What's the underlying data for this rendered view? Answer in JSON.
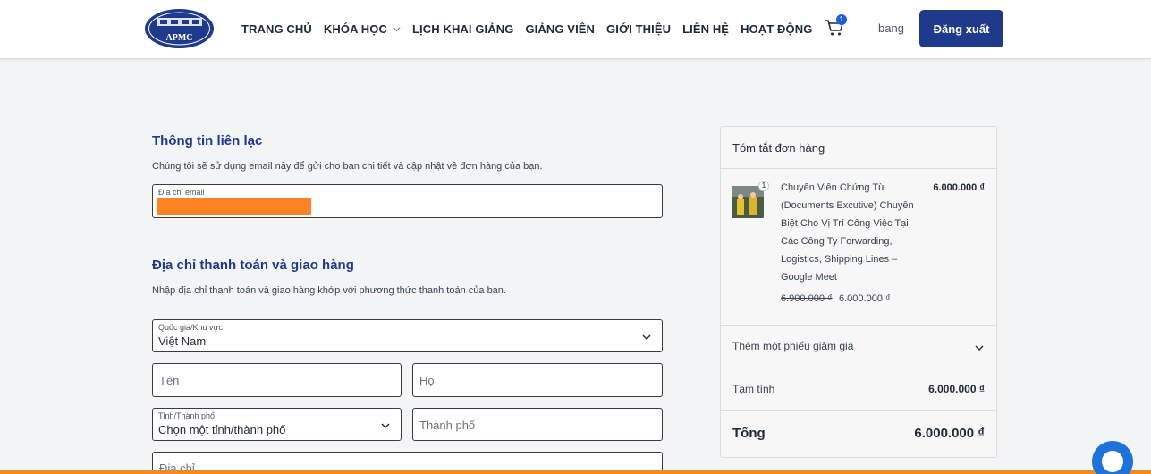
{
  "header": {
    "logo_text": "APMC",
    "nav": [
      {
        "label": "TRANG CHỦ"
      },
      {
        "label": "KHÓA HỌC",
        "has_dropdown": true
      },
      {
        "label": "LỊCH KHAI GIẢNG"
      },
      {
        "label": "GIẢNG VIÊN"
      },
      {
        "label": "GIỚI THIỆU"
      },
      {
        "label": "LIÊN HỆ"
      },
      {
        "label": "HOẠT ĐỘNG"
      }
    ],
    "cart_count": "1",
    "username": "bang",
    "logout_label": "Đăng xuất"
  },
  "contact": {
    "title": "Thông tin liên lạc",
    "description": "Chúng tôi sẽ sử dụng email này để gửi cho bạn chi tiết và cập nhật về đơn hàng của bạn.",
    "email_label": "Địa chỉ email"
  },
  "billing": {
    "title": "Địa chỉ thanh toán và giao hàng",
    "description": "Nhập địa chỉ thanh toán và giao hàng khớp với phương thức thanh toán của bạn.",
    "country_label": "Quốc gia/Khu vực",
    "country_value": "Việt Nam",
    "first_name_placeholder": "Tên",
    "last_name_placeholder": "Họ",
    "province_label": "Tỉnh/Thành phố",
    "province_value": "Chọn một tỉnh/thành phố",
    "city_placeholder": "Thành phố",
    "address_placeholder": "Địa chỉ"
  },
  "summary": {
    "title": "Tóm tắt đơn hàng",
    "item": {
      "quantity": "1",
      "name": "Chuyên Viên Chứng Từ (Documents Excutive) Chuyên Biệt Cho Vị Trí Công Việc Tại Các Công Ty Forwarding, Logistics, Shipping Lines – Google Meet",
      "price": "6.000.000 ₫",
      "old_price": "6.900.000 ₫",
      "new_price": "6.000.000 ₫"
    },
    "coupon_label": "Thêm một phiếu giảm giá",
    "subtotal_label": "Tạm tính",
    "subtotal_value": "6.000.000 ₫",
    "total_label": "Tổng",
    "total_value": "6.000.000 ₫"
  },
  "colors": {
    "brand_blue": "#1f3a8a",
    "accent_orange": "#f08a24",
    "badge_blue": "#1e5bd8"
  }
}
